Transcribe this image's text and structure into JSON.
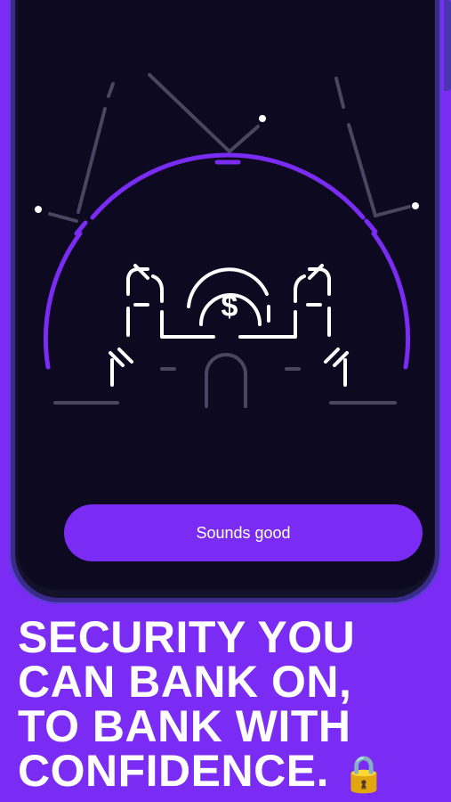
{
  "illustration": {
    "icon": "dollar-coin-icon",
    "symbol": "$"
  },
  "cta": {
    "label": "Sounds good"
  },
  "headline": {
    "lines": [
      "SECURITY YOU",
      "CAN BANK ON,",
      "TO BANK WITH",
      "CONFIDENCE."
    ],
    "emoji": "🔒"
  },
  "colors": {
    "accent": "#7a2cf5",
    "screen_bg": "#0c0920",
    "line": "#4a4560",
    "text": "#ffffff"
  }
}
